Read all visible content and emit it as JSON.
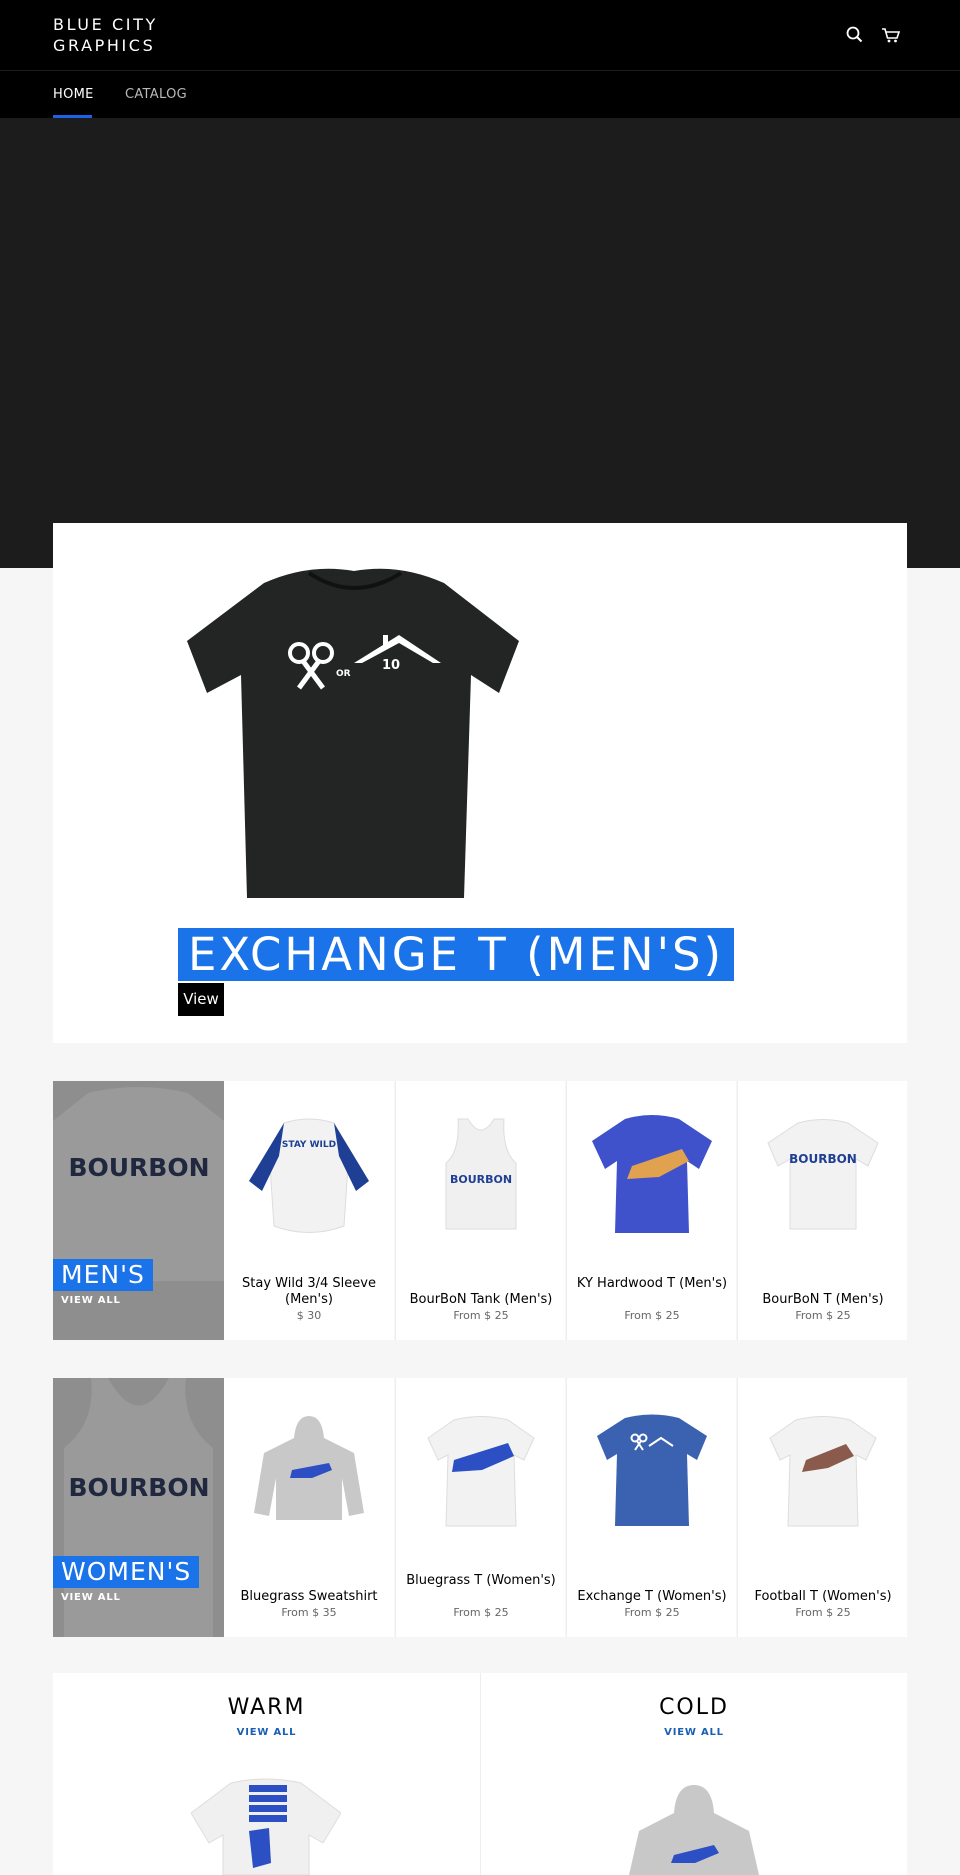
{
  "header": {
    "logo_line1": "BLUE CITY",
    "logo_line2": "GRAPHICS",
    "nav": [
      {
        "label": "HOME",
        "active": true
      },
      {
        "label": "CATALOG",
        "active": false
      }
    ]
  },
  "feature": {
    "title": "EXCHANGE T (MEN'S)",
    "button": "View"
  },
  "collections": [
    {
      "label": "MEN'S",
      "view_all": "VIEW ALL",
      "products": [
        {
          "title": "Stay Wild 3/4 Sleeve (Men's)",
          "price": "$ 30"
        },
        {
          "title": "BourBoN Tank (Men's)",
          "price": "From $ 25"
        },
        {
          "title": "KY Hardwood T (Men's)",
          "price": "From $ 25"
        },
        {
          "title": "BourBoN T (Men's)",
          "price": "From $ 25"
        }
      ]
    },
    {
      "label": "WOMEN'S",
      "view_all": "VIEW ALL",
      "products": [
        {
          "title": "Bluegrass Sweatshirt",
          "price": "From $ 35"
        },
        {
          "title": "Bluegrass T (Women's)",
          "price": "From $ 25"
        },
        {
          "title": "Exchange T (Women's)",
          "price": "From $ 25"
        },
        {
          "title": "Football T (Women's)",
          "price": "From $ 25"
        }
      ]
    }
  ],
  "bottom": [
    {
      "title": "WARM",
      "view_all": "VIEW ALL"
    },
    {
      "title": "COLD",
      "view_all": "VIEW ALL"
    }
  ],
  "graphics": {
    "shirt_text": "BOURBON",
    "raglan_text": "STAY WILD",
    "keys_or": "OR",
    "house_number": "10"
  },
  "colors": {
    "accent": "#1a73e8",
    "header_bg": "#000000",
    "hero_bg": "#1c1c1c"
  }
}
